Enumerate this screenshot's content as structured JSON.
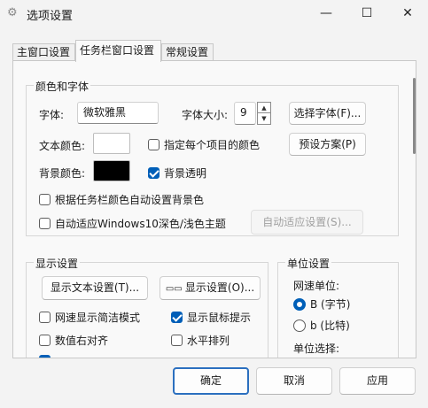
{
  "window": {
    "title": "选项设置",
    "icon": "gear-icon",
    "controls": {
      "minimize": "—",
      "maximize": "☐",
      "close": "✕"
    }
  },
  "tabs": [
    {
      "label": "主窗口设置",
      "active": false
    },
    {
      "label": "任务栏窗口设置",
      "active": true
    },
    {
      "label": "常规设置",
      "active": false
    }
  ],
  "color_font": {
    "title": "颜色和字体",
    "font_label": "字体:",
    "font_value": "微软雅黑",
    "font_size_label": "字体大小:",
    "font_size_value": "9",
    "select_font_button": "选择字体(F)...",
    "text_color_label": "文本颜色:",
    "text_color": "#ffffff",
    "per_item_color_label": "指定每个项目的颜色",
    "per_item_color_checked": false,
    "preset_button": "预设方案(P)",
    "bg_color_label": "背景颜色:",
    "bg_color": "#000000",
    "bg_transparent_label": "背景透明",
    "bg_transparent_checked": true,
    "auto_bg_label": "根据任务栏颜色自动设置背景色",
    "auto_bg_checked": false,
    "auto_theme_label": "自动适应Windows10深色/浅色主题",
    "auto_theme_checked": false,
    "auto_adapt_button": "自动适应设置(S)..."
  },
  "display": {
    "title": "显示设置",
    "text_settings_button": "显示文本设置(T)...",
    "display_settings_button": "显示设置(O)...",
    "options": [
      {
        "label": "网速显示简洁模式",
        "checked": false
      },
      {
        "label": "显示鼠标提示",
        "checked": true
      },
      {
        "label": "数值右对齐",
        "checked": false
      },
      {
        "label": "水平排列",
        "checked": false
      }
    ]
  },
  "units": {
    "title": "单位设置",
    "speed_unit_label": "网速单位:",
    "radio_bytes": "B (字节)",
    "radio_bits": "b (比特)",
    "selected": "B (字节)",
    "unit_select_label": "单位选择:"
  },
  "footer": {
    "ok": "确定",
    "cancel": "取消",
    "apply": "应用"
  }
}
